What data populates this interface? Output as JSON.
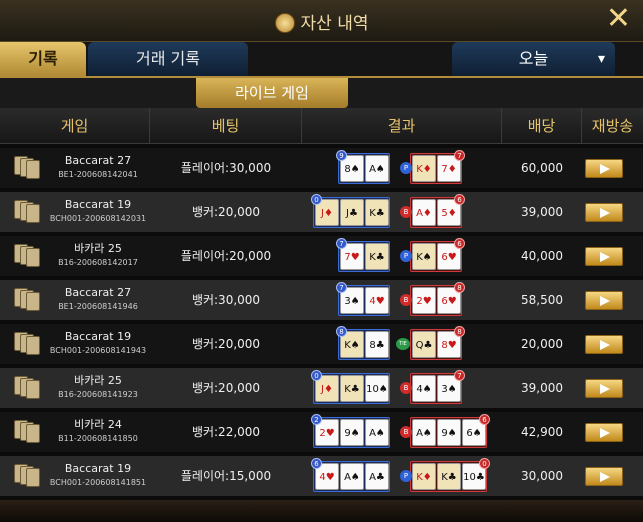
{
  "title": "자산 내역",
  "icons": {
    "title": "coin-icon",
    "close": "close-icon",
    "dropdown": "chevron-down-icon",
    "game": "cards-icon",
    "replay": "play-icon"
  },
  "tabs": {
    "records": "기록",
    "transactions": "거래 기록"
  },
  "period": "오늘",
  "subtab": "라이브 게임",
  "headers": {
    "game": "게임",
    "bet": "베팅",
    "result": "결과",
    "payout": "배당",
    "replay": "재방송"
  },
  "colors": {
    "gold": "#e6c36b",
    "player": "#3257c8",
    "banker": "#c62828",
    "tie": "#2b9b48"
  },
  "rows": [
    {
      "game": "Baccarat 27",
      "id": "BE1-200608142041",
      "bet": "플레이어:30,000",
      "payout": "60,000",
      "player_score": "9",
      "banker_score": "7",
      "winner": "P",
      "player_cards": [
        {
          "r": "8♠",
          "red": false
        },
        {
          "r": "A♠",
          "red": false
        }
      ],
      "banker_cards": [
        {
          "r": "K♦",
          "red": true,
          "face": true
        },
        {
          "r": "7♦",
          "red": true
        }
      ]
    },
    {
      "game": "Baccarat 19",
      "id": "BCH001-200608142031",
      "bet": "뱅커:20,000",
      "payout": "39,000",
      "player_score": "0",
      "banker_score": "6",
      "winner": "B",
      "player_cards": [
        {
          "r": "J♦",
          "red": true,
          "face": true
        },
        {
          "r": "J♣",
          "red": false,
          "face": true
        },
        {
          "r": "K♣",
          "red": false,
          "face": true
        }
      ],
      "banker_cards": [
        {
          "r": "A♦",
          "red": true
        },
        {
          "r": "5♦",
          "red": true
        }
      ]
    },
    {
      "game": "바카라 25",
      "id": "B16-200608142017",
      "bet": "플레이어:20,000",
      "payout": "40,000",
      "player_score": "7",
      "banker_score": "6",
      "winner": "P",
      "player_cards": [
        {
          "r": "7♥",
          "red": true
        },
        {
          "r": "K♣",
          "red": false,
          "face": true
        }
      ],
      "banker_cards": [
        {
          "r": "K♠",
          "red": false,
          "face": true
        },
        {
          "r": "6♥",
          "red": true
        }
      ]
    },
    {
      "game": "Baccarat 27",
      "id": "BE1-200608141946",
      "bet": "뱅커:30,000",
      "payout": "58,500",
      "player_score": "7",
      "banker_score": "8",
      "winner": "B",
      "player_cards": [
        {
          "r": "3♠",
          "red": false
        },
        {
          "r": "4♥",
          "red": true
        }
      ],
      "banker_cards": [
        {
          "r": "2♥",
          "red": true
        },
        {
          "r": "6♥",
          "red": true
        }
      ]
    },
    {
      "game": "Baccarat 19",
      "id": "BCH001-200608141943",
      "bet": "뱅커:20,000",
      "payout": "20,000",
      "player_score": "8",
      "banker_score": "8",
      "winner": "TIE",
      "player_cards": [
        {
          "r": "K♠",
          "red": false,
          "face": true
        },
        {
          "r": "8♣",
          "red": false
        }
      ],
      "banker_cards": [
        {
          "r": "Q♣",
          "red": false,
          "face": true
        },
        {
          "r": "8♥",
          "red": true
        }
      ]
    },
    {
      "game": "바카라 25",
      "id": "B16-200608141923",
      "bet": "뱅커:20,000",
      "payout": "39,000",
      "player_score": "0",
      "banker_score": "7",
      "winner": "B",
      "player_cards": [
        {
          "r": "J♦",
          "red": true,
          "face": true
        },
        {
          "r": "K♣",
          "red": false,
          "face": true
        },
        {
          "r": "10♠",
          "red": false
        }
      ],
      "banker_cards": [
        {
          "r": "4♠",
          "red": false
        },
        {
          "r": "3♠",
          "red": false
        }
      ]
    },
    {
      "game": "비카라 24",
      "id": "B11-200608141850",
      "bet": "뱅커:22,000",
      "payout": "42,900",
      "player_score": "2",
      "banker_score": "6",
      "winner": "B",
      "player_cards": [
        {
          "r": "2♥",
          "red": true
        },
        {
          "r": "9♠",
          "red": false
        },
        {
          "r": "A♠",
          "red": false
        }
      ],
      "banker_cards": [
        {
          "r": "A♠",
          "red": false
        },
        {
          "r": "9♠",
          "red": false
        },
        {
          "r": "6♠",
          "red": false
        }
      ]
    },
    {
      "game": "Baccarat 19",
      "id": "BCH001-200608141851",
      "bet": "플레이어:15,000",
      "payout": "30,000",
      "player_score": "6",
      "banker_score": "0",
      "winner": "P",
      "player_cards": [
        {
          "r": "4♥",
          "red": true
        },
        {
          "r": "A♠",
          "red": false
        },
        {
          "r": "A♣",
          "red": false
        }
      ],
      "banker_cards": [
        {
          "r": "K♦",
          "red": true,
          "face": true
        },
        {
          "r": "K♣",
          "red": false,
          "face": true
        },
        {
          "r": "10♣",
          "red": false
        }
      ]
    }
  ]
}
